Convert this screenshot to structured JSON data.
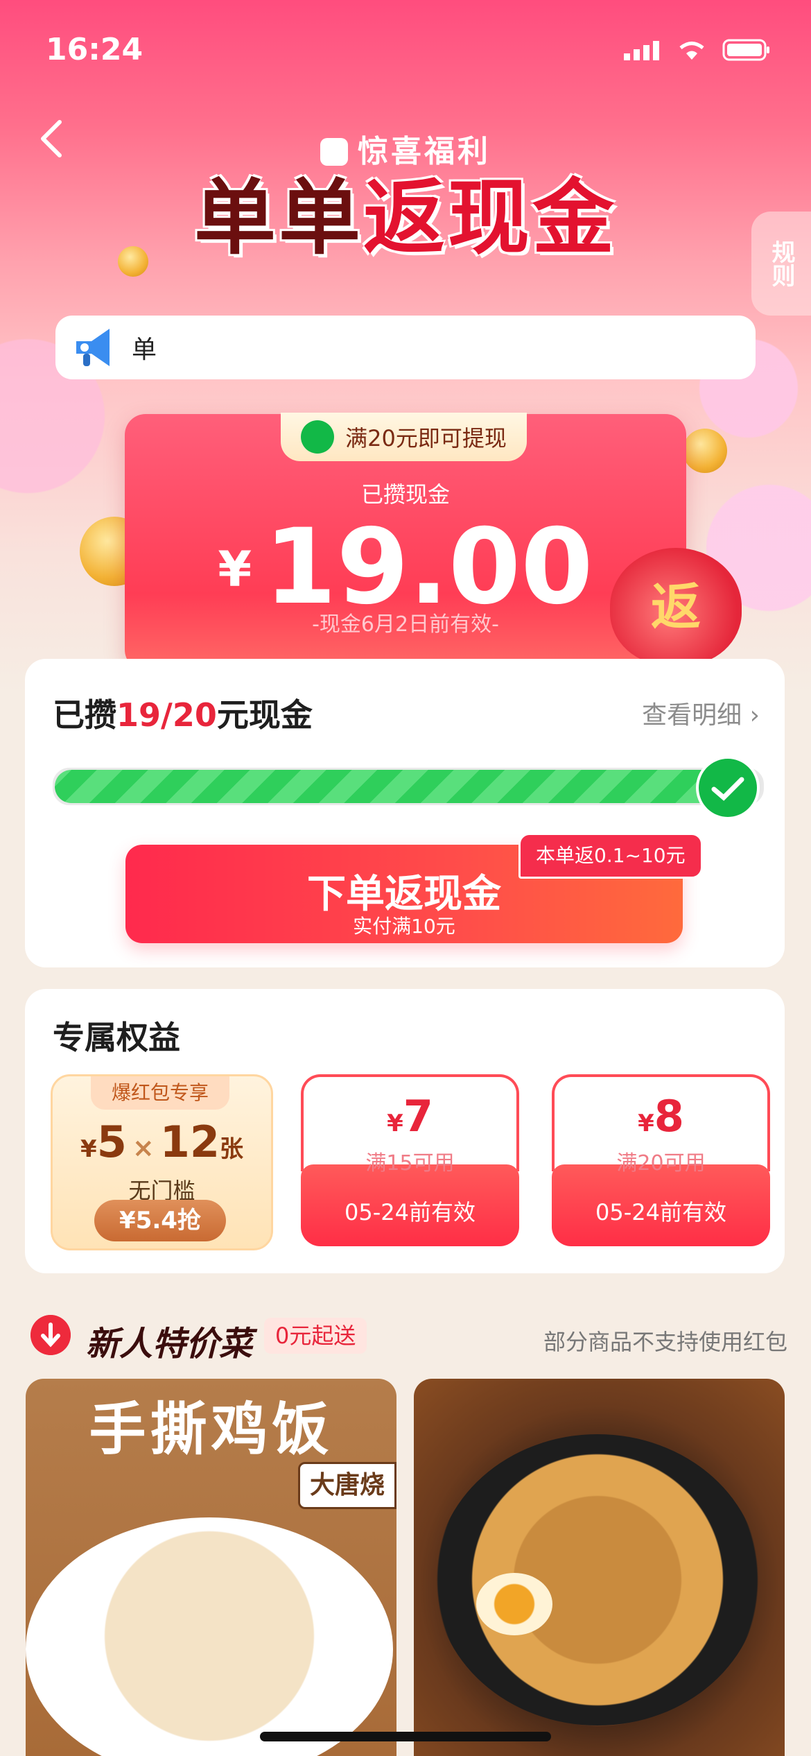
{
  "status_bar": {
    "time": "16:24"
  },
  "header": {
    "brand": "惊喜福利",
    "headline_part1": "单单",
    "headline_part2": "返现金",
    "rule_tab": "规则"
  },
  "notice": {
    "text": "单"
  },
  "balance": {
    "tip": "满20元即可提现",
    "label": "已攒现金",
    "currency": "¥",
    "amount": "19.00",
    "validity": "-现金6月2日前有效-",
    "bag_char": "返"
  },
  "progress": {
    "title_prefix": "已攒",
    "title_progress": "19/20",
    "title_suffix": "元现金",
    "detail_link": "查看明细 ›",
    "fraction": 0.95,
    "cta_main": "下单返现金",
    "cta_sub": "实付满10元",
    "cta_badge": "本单返0.1~10元"
  },
  "benefits": {
    "title": "专属权益",
    "red_packet": {
      "tag": "爆红包专享",
      "currency": "¥",
      "value": "5",
      "times": "×",
      "count": "12",
      "unit": "张",
      "condition": "无门槛",
      "button": "¥5.4抢"
    },
    "coupons": [
      {
        "currency": "¥",
        "amount": "7",
        "condition": "满15可用",
        "expiry": "05-24前有效"
      },
      {
        "currency": "¥",
        "amount": "8",
        "condition": "满20可用",
        "expiry": "05-24前有效"
      }
    ]
  },
  "new_user": {
    "title": "新人特价菜",
    "tag": "0元起送",
    "note": "部分商品不支持使用红包",
    "items": [
      {
        "name": "手撕鸡饭",
        "shop": "大唐烧"
      },
      {
        "name": ""
      }
    ]
  },
  "colors": {
    "accent": "#e8253b",
    "wechat_green": "#12b847",
    "progress_green": "#2fcf5b"
  }
}
